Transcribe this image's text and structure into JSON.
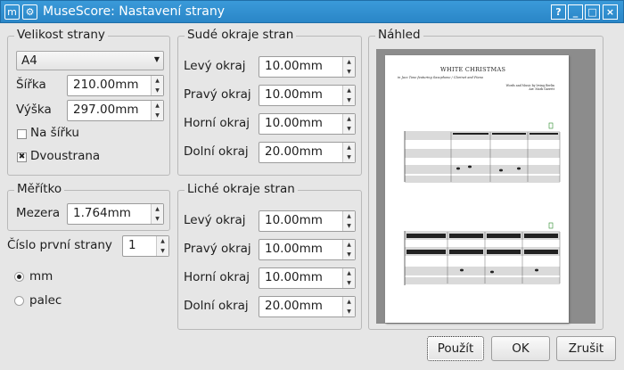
{
  "window": {
    "title": "MuseScore: Nastavení strany",
    "app_icon": "musescore-app-icon",
    "pin_icon": "pin-icon",
    "controls": {
      "help": "?",
      "minimize": "_",
      "maximize": "□",
      "close": "×"
    }
  },
  "page_size": {
    "title": "Velikost strany",
    "format": "A4",
    "width_label": "Šířka",
    "width": "210.00mm",
    "height_label": "Výška",
    "height": "297.00mm",
    "landscape_label": "Na šířku",
    "landscape": false,
    "twosided_label": "Dvoustrana",
    "twosided": true
  },
  "scale": {
    "title": "Měřítko",
    "spacing_label": "Mezera",
    "spacing": "1.764mm"
  },
  "first_page": {
    "label": "Číslo první strany",
    "value": "1"
  },
  "units": {
    "mm": "mm",
    "inch": "palec",
    "selected": "mm"
  },
  "even_margins": {
    "title": "Sudé okraje stran",
    "left_label": "Levý okraj",
    "left": "10.00mm",
    "right_label": "Pravý okraj",
    "right": "10.00mm",
    "top_label": "Horní okraj",
    "top": "10.00mm",
    "bottom_label": "Dolní okraj",
    "bottom": "20.00mm"
  },
  "odd_margins": {
    "title": "Liché okraje stran",
    "left_label": "Levý okraj",
    "left": "10.00mm",
    "right_label": "Pravý okraj",
    "right": "10.00mm",
    "top_label": "Horní okraj",
    "top": "10.00mm",
    "bottom_label": "Dolní okraj",
    "bottom": "20.00mm"
  },
  "preview": {
    "title": "Náhled",
    "score_title": "WHITE CHRISTMAS",
    "score_subtitle": "in Jazz Tone featuring Saxophone / Clarinet and Piano",
    "score_credit_1": "Words and Music by Irving Berlin",
    "score_credit_2": "Arr. Mark Garrett"
  },
  "buttons": {
    "apply": "Použít",
    "ok": "OK",
    "cancel": "Zrušit"
  },
  "colors": {
    "titlebar": "#2a86c7",
    "window_bg": "#e6e6e6",
    "preview_bg": "#8c8c8c"
  }
}
